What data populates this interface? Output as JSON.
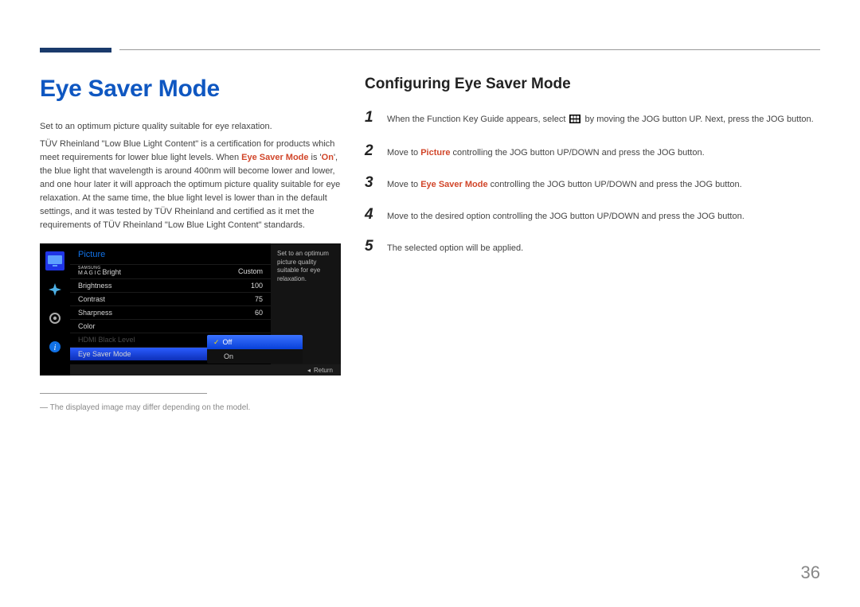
{
  "page": {
    "number": "36"
  },
  "left": {
    "heading": "Eye Saver Mode",
    "p1": "Set to an optimum picture quality suitable for eye relaxation.",
    "p2_before": "TÜV Rheinland \"Low Blue Light Content\" is a certification for products which meet requirements for lower blue light levels. When ",
    "p2_em1": "Eye Saver Mode",
    "p2_mid": " is '",
    "p2_em2": "On",
    "p2_after": "', the blue light that wavelength is around 400nm will become lower and lower, and one hour later it will approach the optimum picture quality suitable for eye relaxation. At the same time, the blue light level is lower than in the default settings, and it was tested by TÜV Rheinland and certified as it met the requirements of TÜV Rheinland \"Low Blue Light Content\" standards.",
    "disclaimer": "The displayed image may differ depending on the model."
  },
  "right": {
    "heading": "Configuring Eye Saver Mode",
    "steps": [
      {
        "num": "1",
        "pre": "When the Function Key Guide appears, select ",
        "post": " by moving the JOG button UP. Next, press the JOG button."
      },
      {
        "num": "2",
        "pre": "Move to ",
        "em": "Picture",
        "post": " controlling the JOG button UP/DOWN and press the JOG button."
      },
      {
        "num": "3",
        "pre": "Move to  ",
        "em": "Eye Saver Mode",
        "post": " controlling the JOG button UP/DOWN and press the JOG button."
      },
      {
        "num": "4",
        "pre": "Move to the desired option controlling the JOG button UP/DOWN and press the JOG button.",
        "em": "",
        "post": ""
      },
      {
        "num": "5",
        "pre": "The selected option will be applied.",
        "em": "",
        "post": ""
      }
    ]
  },
  "osd": {
    "title": "Picture",
    "tip": "Set to an optimum picture quality suitable for eye relaxation.",
    "rows": {
      "magic_brand": "SAMSUNG",
      "magic_word": "MAGIC",
      "magic_suffix": "Bright",
      "magic_val": "Custom",
      "brightness": "Brightness",
      "brightness_val": "100",
      "contrast": "Contrast",
      "contrast_val": "75",
      "sharpness": "Sharpness",
      "sharpness_val": "60",
      "color": "Color",
      "hdmi": "HDMI Black Level",
      "eyesaver": "Eye Saver Mode"
    },
    "options": {
      "off": "Off",
      "on": "On"
    },
    "footer": "Return"
  }
}
